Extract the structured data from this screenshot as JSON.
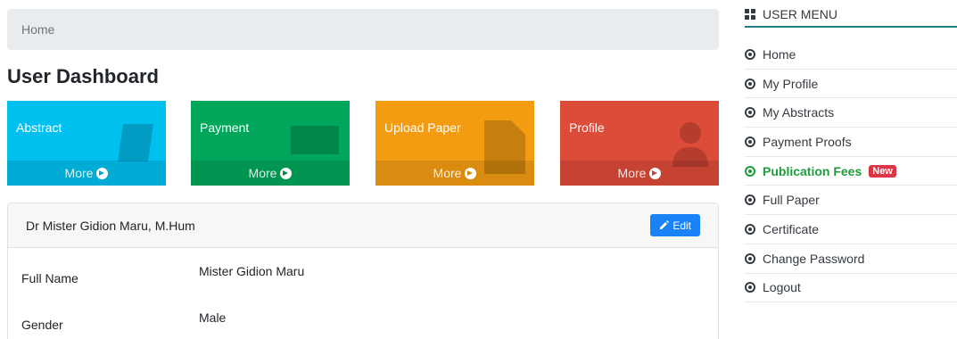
{
  "breadcrumb": {
    "home": "Home"
  },
  "page_title": "User Dashboard",
  "boxes": [
    {
      "label": "Abstract",
      "more": "More",
      "icon": "book-icon",
      "color": "#00c0ef"
    },
    {
      "label": "Payment",
      "more": "More",
      "icon": "money-icon",
      "color": "#00a65a"
    },
    {
      "label": "Upload Paper",
      "more": "More",
      "icon": "file-icon",
      "color": "#f39c12"
    },
    {
      "label": "Profile",
      "more": "More",
      "icon": "user-icon",
      "color": "#dd4b39"
    }
  ],
  "profile_card": {
    "name": "Dr Mister Gidion Maru, M.Hum",
    "edit_label": "Edit",
    "rows": [
      {
        "key": "Full Name",
        "value": "Mister Gidion Maru"
      },
      {
        "key": "Gender",
        "value": "Male"
      }
    ]
  },
  "sidebar": {
    "title": "USER MENU",
    "items": [
      {
        "label": "Home"
      },
      {
        "label": "My Profile"
      },
      {
        "label": "My Abstracts"
      },
      {
        "label": "Payment Proofs"
      },
      {
        "label": "Publication Fees",
        "badge": "New",
        "active": true
      },
      {
        "label": "Full Paper"
      },
      {
        "label": "Certificate"
      },
      {
        "label": "Change Password"
      },
      {
        "label": "Logout"
      }
    ],
    "active_color": "#1e9c3c"
  }
}
